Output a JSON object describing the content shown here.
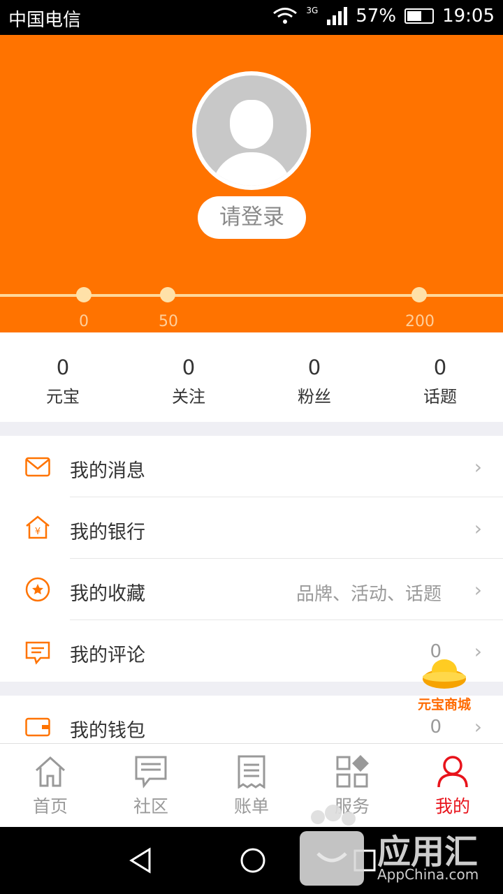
{
  "status": {
    "carrier": "中国电信",
    "network": "3G",
    "battery": "57%",
    "time": "19:05"
  },
  "hero": {
    "login_label": "请登录",
    "ticks": [
      "0",
      "50",
      "200"
    ]
  },
  "stats": [
    {
      "value": "0",
      "label": "元宝"
    },
    {
      "value": "0",
      "label": "关注"
    },
    {
      "value": "0",
      "label": "粉丝"
    },
    {
      "value": "0",
      "label": "话题"
    }
  ],
  "menu": [
    {
      "label": "我的消息",
      "extra": "",
      "icon": "mail-icon"
    },
    {
      "label": "我的银行",
      "extra": "",
      "icon": "bank-icon"
    },
    {
      "label": "我的收藏",
      "extra": "品牌、活动、话题",
      "icon": "star-icon"
    },
    {
      "label": "我的评论",
      "extra": "0",
      "icon": "comment-icon"
    },
    {
      "label": "我的钱包",
      "extra": "0",
      "icon": "wallet-icon"
    }
  ],
  "floating": {
    "mall_label": "元宝商城"
  },
  "tabs": [
    {
      "label": "首页",
      "icon": "home-icon",
      "active": false
    },
    {
      "label": "社区",
      "icon": "chat-icon",
      "active": false
    },
    {
      "label": "账单",
      "icon": "bill-icon",
      "active": false
    },
    {
      "label": "服务",
      "icon": "grid-icon",
      "active": false
    },
    {
      "label": "我的",
      "icon": "user-icon",
      "active": true
    }
  ],
  "colors": {
    "accent": "#ff7300",
    "active_tab": "#e8131b"
  },
  "watermark": {
    "text": "应用汇",
    "sub": "AppChina.com"
  }
}
